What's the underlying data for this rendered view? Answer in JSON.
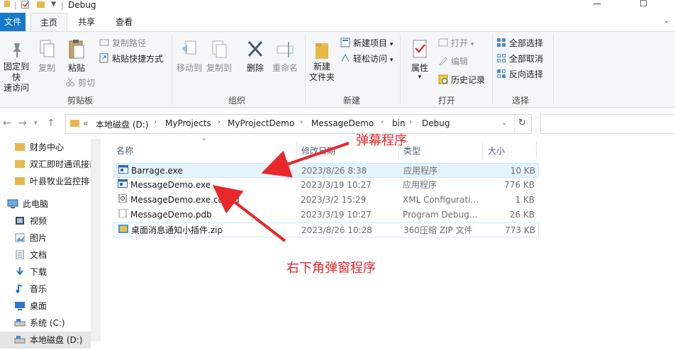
{
  "window": {
    "title": "Debug"
  },
  "tabs": {
    "file": "文件",
    "home": "主页",
    "share": "共享",
    "view": "查看"
  },
  "ribbon": {
    "clipboard": {
      "pin_quick": "固定到快\n速访问",
      "copy": "复制",
      "paste": "粘贴",
      "copy_path": "复制路径",
      "paste_shortcut": "粘贴快捷方式",
      "cut": "剪切",
      "group": "剪贴板"
    },
    "organize": {
      "move_to": "移动到",
      "copy_to": "复制到",
      "delete": "删除",
      "rename": "重命名",
      "group": "组织"
    },
    "new": {
      "new_folder": "新建\n文件夹",
      "new_item": "新建项目",
      "easy_access": "轻松访问",
      "group": "新建"
    },
    "open": {
      "properties": "属性",
      "open": "打开",
      "edit": "编辑",
      "history": "历史记录",
      "group": "打开"
    },
    "select": {
      "select_all": "全部选择",
      "select_none": "全部取消",
      "invert": "反向选择",
      "group": "选择"
    }
  },
  "address": {
    "prefix": "«",
    "crumbs": [
      "本地磁盘 (D:)",
      "MyProjects",
      "MyProjectDemo",
      "MessageDemo",
      "bin",
      "Debug"
    ]
  },
  "nav": {
    "items": [
      {
        "label": "财务中心",
        "icon": "folder-icon"
      },
      {
        "label": "双汇即时通讯接口",
        "icon": "folder-icon"
      },
      {
        "label": "叶县牧业监控排",
        "icon": "folder-icon"
      },
      {
        "label": "此电脑",
        "icon": "computer-icon"
      },
      {
        "label": "视频",
        "icon": "video-icon"
      },
      {
        "label": "图片",
        "icon": "pictures-icon"
      },
      {
        "label": "文档",
        "icon": "documents-icon"
      },
      {
        "label": "下载",
        "icon": "download-icon"
      },
      {
        "label": "音乐",
        "icon": "music-icon"
      },
      {
        "label": "桌面",
        "icon": "desktop-icon"
      },
      {
        "label": "系统 (C:)",
        "icon": "drive-icon"
      },
      {
        "label": "本地磁盘 (D:)",
        "icon": "drive-icon"
      }
    ]
  },
  "columns": {
    "name": "名称",
    "date": "修改日期",
    "type": "类型",
    "size": "大小"
  },
  "files": [
    {
      "name": "Barrage.exe",
      "date": "2023/8/26 8:38",
      "type": "应用程序",
      "size": "10 KB",
      "icon": "exe-icon"
    },
    {
      "name": "MessageDemo.exe",
      "date": "2023/3/19 10:27",
      "type": "应用程序",
      "size": "776 KB",
      "icon": "exe-icon"
    },
    {
      "name": "MessageDemo.exe.config",
      "date": "2023/3/2 15:29",
      "type": "XML Configurati...",
      "size": "1 KB",
      "icon": "config-icon"
    },
    {
      "name": "MessageDemo.pdb",
      "date": "2023/3/19 10:27",
      "type": "Program Debug...",
      "size": "26 KB",
      "icon": "pdb-icon"
    },
    {
      "name": "桌面消息通知小插件.zip",
      "date": "2023/8/26 10:28",
      "type": "360压缩 ZIP 文件",
      "size": "773 KB",
      "icon": "zip-icon"
    }
  ],
  "annotations": {
    "barrage": "弹幕程序",
    "popup": "右下角弹窗程序"
  },
  "colors": {
    "accent": "#1979ca",
    "annotation": "#e8282a",
    "selection": "#e5f3ff"
  }
}
